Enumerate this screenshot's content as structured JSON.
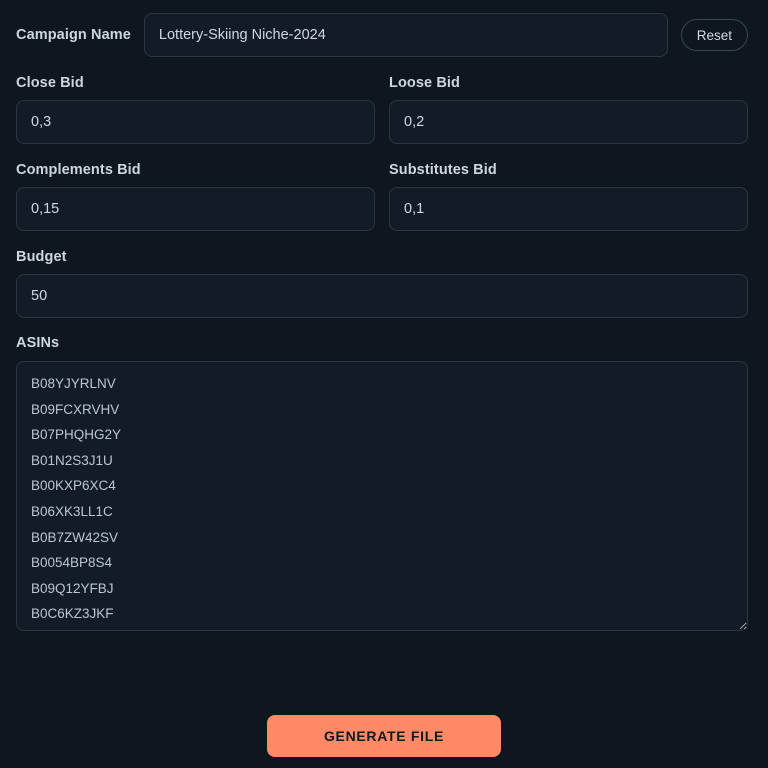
{
  "theme": {
    "background": "#0f1620",
    "field_background": "#131c26",
    "field_border": "#2b3643",
    "label_color": "#ccd6e0",
    "accent": "#ff8a65",
    "accent_text": "#111820"
  },
  "form": {
    "campaign": {
      "label": "Campaign Name",
      "value": "Lottery-Skiing Niche-2024",
      "placeholder": "Campaign Name"
    },
    "reset_label": "Reset",
    "close_bid": {
      "label": "Close Bid",
      "value": "0,3",
      "placeholder": "Close Bid"
    },
    "loose_bid": {
      "label": "Loose Bid",
      "value": "0,2",
      "placeholder": "Loose Bid"
    },
    "complements_bid": {
      "label": "Complements Bid",
      "value": "0,15",
      "placeholder": "Complements Bid"
    },
    "substitutes_bid": {
      "label": "Substitutes Bid",
      "value": "0,1",
      "placeholder": "Substitutes Bid"
    },
    "budget": {
      "label": "Budget",
      "value": "50",
      "placeholder": "Budget"
    },
    "asins": {
      "label": "ASINs",
      "placeholder": "ASINs",
      "items": [
        "B08YJYRLNV",
        "B09FCXRVHV",
        "B07PHQHG2Y",
        "B01N2S3J1U",
        "B00KXP6XC4",
        "B06XK3LL1C",
        "B0B7ZW42SV",
        "B0054BP8S4",
        "B09Q12YFBJ",
        "B0C6KZ3JKF"
      ],
      "value": "B08YJYRLNV\nB09FCXRVHV\nB07PHQHG2Y\nB01N2S3J1U\nB00KXP6XC4\nB06XK3LL1C\nB0B7ZW42SV\nB0054BP8S4\nB09Q12YFBJ\nB0C6KZ3JKF"
    },
    "generate_label": "GENERATE FILE"
  }
}
